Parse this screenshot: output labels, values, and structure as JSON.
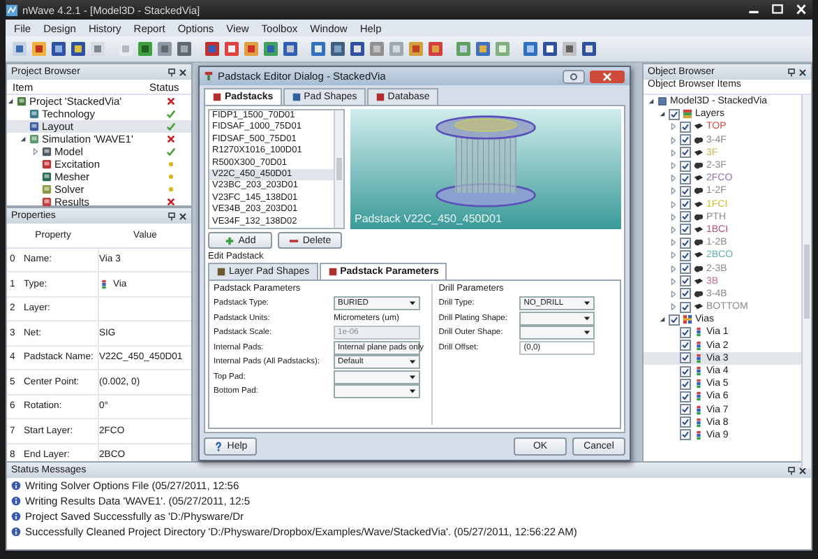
{
  "window": {
    "title": "nWave 4.2.1 - [Model3D - StackedVia]"
  },
  "menu": [
    "File",
    "Design",
    "History",
    "Report",
    "Options",
    "View",
    "Toolbox",
    "Window",
    "Help"
  ],
  "project_browser": {
    "title": "Project Browser",
    "columns": [
      "Item",
      "Status"
    ],
    "tree": [
      {
        "label": "Project 'StackedVia'",
        "kind": "project",
        "failed": true,
        "expanded": true,
        "selected": false,
        "children": [
          {
            "label": "Technology",
            "kind": "technology",
            "complete": true,
            "failed": false,
            "selected": false
          },
          {
            "label": "Layout",
            "kind": "layout",
            "complete": true,
            "failed": false,
            "selected": true
          },
          {
            "label": "Simulation 'WAVE1'",
            "kind": "simulation",
            "failed": true,
            "expanded": true,
            "selected": false,
            "children": [
              {
                "label": "Model",
                "kind": "model",
                "complete": true,
                "failed": false,
                "expanded": false,
                "selected": false
              },
              {
                "label": "Excitation",
                "kind": "excitation",
                "complete": false,
                "failed": false,
                "selected": false
              },
              {
                "label": "Mesher",
                "kind": "mesher",
                "complete": false,
                "failed": false,
                "selected": false
              },
              {
                "label": "Solver",
                "kind": "solver",
                "complete": false,
                "failed": false,
                "selected": false
              },
              {
                "label": "Results",
                "kind": "results",
                "failed": true,
                "selected": false
              }
            ]
          }
        ]
      }
    ]
  },
  "properties": {
    "title": "Properties",
    "columns": [
      "Property",
      "Value"
    ],
    "rows": [
      {
        "index": "0",
        "name": "Name:",
        "value": "Via 3"
      },
      {
        "index": "1",
        "name": "Type:",
        "value": "Via",
        "kind": "with_icon"
      },
      {
        "index": "2",
        "name": "Layer:"
      },
      {
        "index": "3",
        "name": "Net:",
        "value": "SIG"
      },
      {
        "index": "4",
        "name": "Padstack Name:",
        "value": "V22C_450_450D01"
      },
      {
        "index": "5",
        "name": "Center Point:",
        "value": "(0.002, 0)"
      },
      {
        "index": "6",
        "name": "Rotation:",
        "value": "0°"
      },
      {
        "index": "7",
        "name": "Start Layer:",
        "value": "2FCO"
      },
      {
        "index": "8",
        "name": "End Layer:",
        "value": "2BCO"
      }
    ]
  },
  "dialog": {
    "title": "Padstack Editor Dialog - StackedVia",
    "tabs": [
      {
        "label": "Padstacks",
        "selected": true
      },
      {
        "label": "Pad Shapes",
        "selected": false
      },
      {
        "label": "Database",
        "selected": false
      }
    ],
    "padstacks": [
      {
        "name": "FIDP1_1500_70D01",
        "selected": false
      },
      {
        "name": "FIDSAF_1000_75D01",
        "selected": false
      },
      {
        "name": "FIDSAF_500_75D01",
        "selected": false
      },
      {
        "name": "R1270X1016_100D01",
        "selected": false
      },
      {
        "name": "R500X300_70D01",
        "selected": false
      },
      {
        "name": "V22C_450_450D01",
        "selected": true
      },
      {
        "name": "V23BC_203_203D01",
        "selected": false
      },
      {
        "name": "V23FC_145_138D01",
        "selected": false
      },
      {
        "name": "VE34B_203_203D01",
        "selected": false
      },
      {
        "name": "VE34F_132_138D02",
        "selected": false
      }
    ],
    "preview_label": "Padstack V22C_450_450D01",
    "list_buttons": [
      {
        "label": "Add",
        "kind": "add"
      },
      {
        "label": "Delete",
        "kind": "delete"
      }
    ],
    "edit_label": "Edit Padstack",
    "edit_tabs": [
      {
        "label": "Layer Pad Shapes",
        "selected": false
      },
      {
        "label": "Padstack Parameters",
        "selected": true
      }
    ],
    "groups": [
      {
        "title": "Padstack Parameters",
        "fields": [
          {
            "label": "Padstack Type:",
            "kind": "select",
            "value": "BURIED"
          },
          {
            "label": "Padstack Units:",
            "kind": "text",
            "value": "Micrometers (um)"
          },
          {
            "label": "Padstack Scale:",
            "kind": "input",
            "value": "1e-06",
            "disabled": true
          },
          {
            "label": "Internal Pads:",
            "kind": "select",
            "value": "Internal plane pads only"
          },
          {
            "label": "Internal Pads (All Padstacks):",
            "kind": "select",
            "value": "Default"
          },
          {
            "label": "Top Pad:",
            "kind": "select"
          },
          {
            "label": "Bottom Pad:",
            "kind": "select"
          }
        ]
      },
      {
        "title": "Drill Parameters",
        "fields": [
          {
            "label": "Drill Type:",
            "kind": "select",
            "value": "NO_DRILL"
          },
          {
            "label": "Drill Plating Shape:",
            "kind": "select"
          },
          {
            "label": "Drill Outer Shape:",
            "kind": "select"
          },
          {
            "label": "Drill Offset:",
            "kind": "input",
            "value": "(0,0)",
            "disabled": false
          }
        ]
      }
    ],
    "footer": [
      {
        "label": "Help",
        "kind": "help"
      },
      {
        "label": "OK",
        "kind": "ok"
      },
      {
        "label": "Cancel",
        "kind": "cancel"
      }
    ]
  },
  "object_browser": {
    "title": "Object Browser",
    "header": "Object Browser Items",
    "tree": [
      {
        "label": "Model3D - StackedVia",
        "kind": "model",
        "expanded": true,
        "selected": false,
        "children": [
          {
            "label": "Layers",
            "kind": "layers",
            "checked": true,
            "expanded": true,
            "selected": false,
            "children": [
              {
                "label": "TOP",
                "kind": "signal",
                "color": "#d04848",
                "checked": true,
                "expanded": false,
                "selected": false
              },
              {
                "label": "3-4F",
                "kind": "dielectric",
                "color": "#8a8a8a",
                "checked": true,
                "expanded": false,
                "selected": false
              },
              {
                "label": "3F",
                "kind": "signal",
                "color": "#c8b850",
                "checked": true,
                "expanded": false,
                "selected": false
              },
              {
                "label": "2-3F",
                "kind": "dielectric",
                "color": "#8a8a8a",
                "checked": true,
                "expanded": false,
                "selected": false
              },
              {
                "label": "2FCO",
                "kind": "signal",
                "color": "#9070b0",
                "checked": true,
                "expanded": false,
                "selected": false
              },
              {
                "label": "1-2F",
                "kind": "dielectric",
                "color": "#8a8a8a",
                "checked": true,
                "expanded": false,
                "selected": false
              },
              {
                "label": "1FCI",
                "kind": "signal",
                "color": "#d0c030",
                "checked": true,
                "expanded": false,
                "selected": false
              },
              {
                "label": "PTH",
                "kind": "dielectric",
                "color": "#8a8a8a",
                "checked": true,
                "expanded": false,
                "selected": false
              },
              {
                "label": "1BCI",
                "kind": "signal",
                "color": "#b05080",
                "checked": true,
                "expanded": false,
                "selected": false
              },
              {
                "label": "1-2B",
                "kind": "dielectric",
                "color": "#8a8a8a",
                "checked": true,
                "expanded": false,
                "selected": false
              },
              {
                "label": "2BCO",
                "kind": "signal",
                "color": "#60b0b0",
                "checked": true,
                "expanded": false,
                "selected": false
              },
              {
                "label": "2-3B",
                "kind": "dielectric",
                "color": "#8a8a8a",
                "checked": true,
                "expanded": false,
                "selected": false
              },
              {
                "label": "3B",
                "kind": "signal",
                "color": "#c07090",
                "checked": true,
                "expanded": false,
                "selected": false
              },
              {
                "label": "3-4B",
                "kind": "dielectric",
                "color": "#8a8a8a",
                "checked": true,
                "expanded": false,
                "selected": false
              },
              {
                "label": "BOTTOM",
                "kind": "signal",
                "color": "#8a8a8a",
                "checked": true,
                "expanded": false,
                "selected": false
              }
            ]
          },
          {
            "label": "Vias",
            "kind": "vias",
            "checked": true,
            "expanded": true,
            "selected": false,
            "children": [
              {
                "label": "Via 1",
                "kind": "via",
                "checked": true,
                "selected": false
              },
              {
                "label": "Via 2",
                "kind": "via",
                "checked": true,
                "selected": false
              },
              {
                "label": "Via 3",
                "kind": "via",
                "checked": true,
                "selected": true
              },
              {
                "label": "Via 4",
                "kind": "via",
                "checked": true,
                "selected": false
              },
              {
                "label": "Via 5",
                "kind": "via",
                "checked": true,
                "selected": false
              },
              {
                "label": "Via 6",
                "kind": "via",
                "checked": true,
                "selected": false
              },
              {
                "label": "Via 7",
                "kind": "via",
                "checked": true,
                "selected": false
              },
              {
                "label": "Via 8",
                "kind": "via",
                "checked": true,
                "selected": false
              },
              {
                "label": "Via 9",
                "kind": "via",
                "checked": true,
                "selected": false
              }
            ]
          }
        ]
      }
    ]
  },
  "status": {
    "title": "Status Messages",
    "messages": [
      "Writing Solver Options File (05/27/2011, 12:56",
      "Writing Results Data 'WAVE1'. (05/27/2011, 12:5",
      "Project Saved Successfully as 'D:/Physware/Dr",
      "Successfully Cleaned Project Directory 'D:/Physware/Dropbox/Examples/Wave/StackedVia'. (05/27/2011, 12:56:22 AM)"
    ]
  }
}
